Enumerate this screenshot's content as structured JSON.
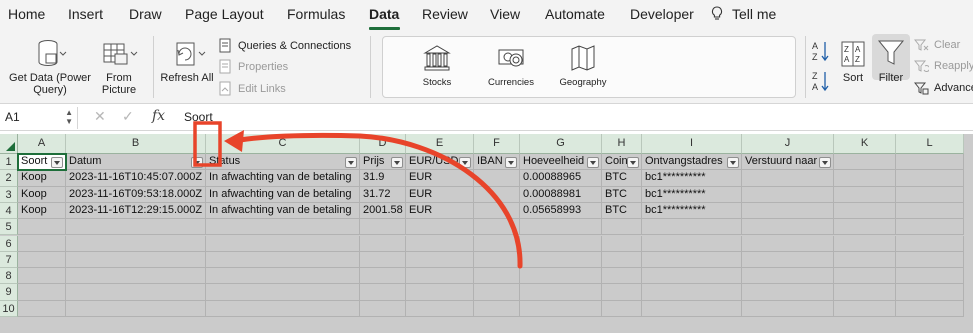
{
  "tabs": [
    "Home",
    "Insert",
    "Draw",
    "Page Layout",
    "Formulas",
    "Data",
    "Review",
    "View",
    "Automate",
    "Developer",
    "Tell me"
  ],
  "active_tab": "Data",
  "ribbon": {
    "get_data": "Get Data (Power Query)",
    "from_picture": "From Picture",
    "refresh_all": "Refresh All",
    "queries": "Queries & Connections",
    "properties": "Properties",
    "edit_links": "Edit Links",
    "stocks": "Stocks",
    "currencies": "Currencies",
    "geography": "Geography",
    "sort": "Sort",
    "filter": "Filter",
    "clear": "Clear",
    "reapply": "Reapply",
    "advanced": "Advanced"
  },
  "formula_bar": {
    "name_box": "A1",
    "fx": "fx",
    "content": "Soort"
  },
  "columns": [
    "A",
    "B",
    "C",
    "D",
    "E",
    "F",
    "G",
    "H",
    "I",
    "J",
    "K",
    "L"
  ],
  "rows": [
    "1",
    "2",
    "3",
    "4",
    "5",
    "6",
    "7",
    "8",
    "9",
    "10"
  ],
  "headers": [
    "Soort",
    "Datum",
    "Status",
    "Prijs",
    "EUR/USD",
    "IBAN",
    "Hoeveelheid",
    "Coin",
    "Ontvangstadres",
    "Verstuurd naar"
  ],
  "data_rows": [
    [
      "Koop",
      "2023-11-16T10:45:07.000Z",
      "In afwachting van de betaling",
      "31.9",
      "EUR",
      "",
      "0.00088965",
      "BTC",
      "bc1**********"
    ],
    [
      "Koop",
      "2023-11-16T09:53:18.000Z",
      "In afwachting van de betaling",
      "31.72",
      "EUR",
      "",
      "0.00088981",
      "BTC",
      "bc1**********"
    ],
    [
      "Koop",
      "2023-11-16T12:29:15.000Z",
      "In afwachting van de betaling",
      "2001.58",
      "EUR",
      "",
      "0.05658993",
      "BTC",
      "bc1**********"
    ]
  ],
  "colors": {
    "accent": "#1e6e3a",
    "annotation": "#e8442a",
    "header_bg": "#dbe9dd",
    "grid_bg": "#cbcbcb"
  }
}
